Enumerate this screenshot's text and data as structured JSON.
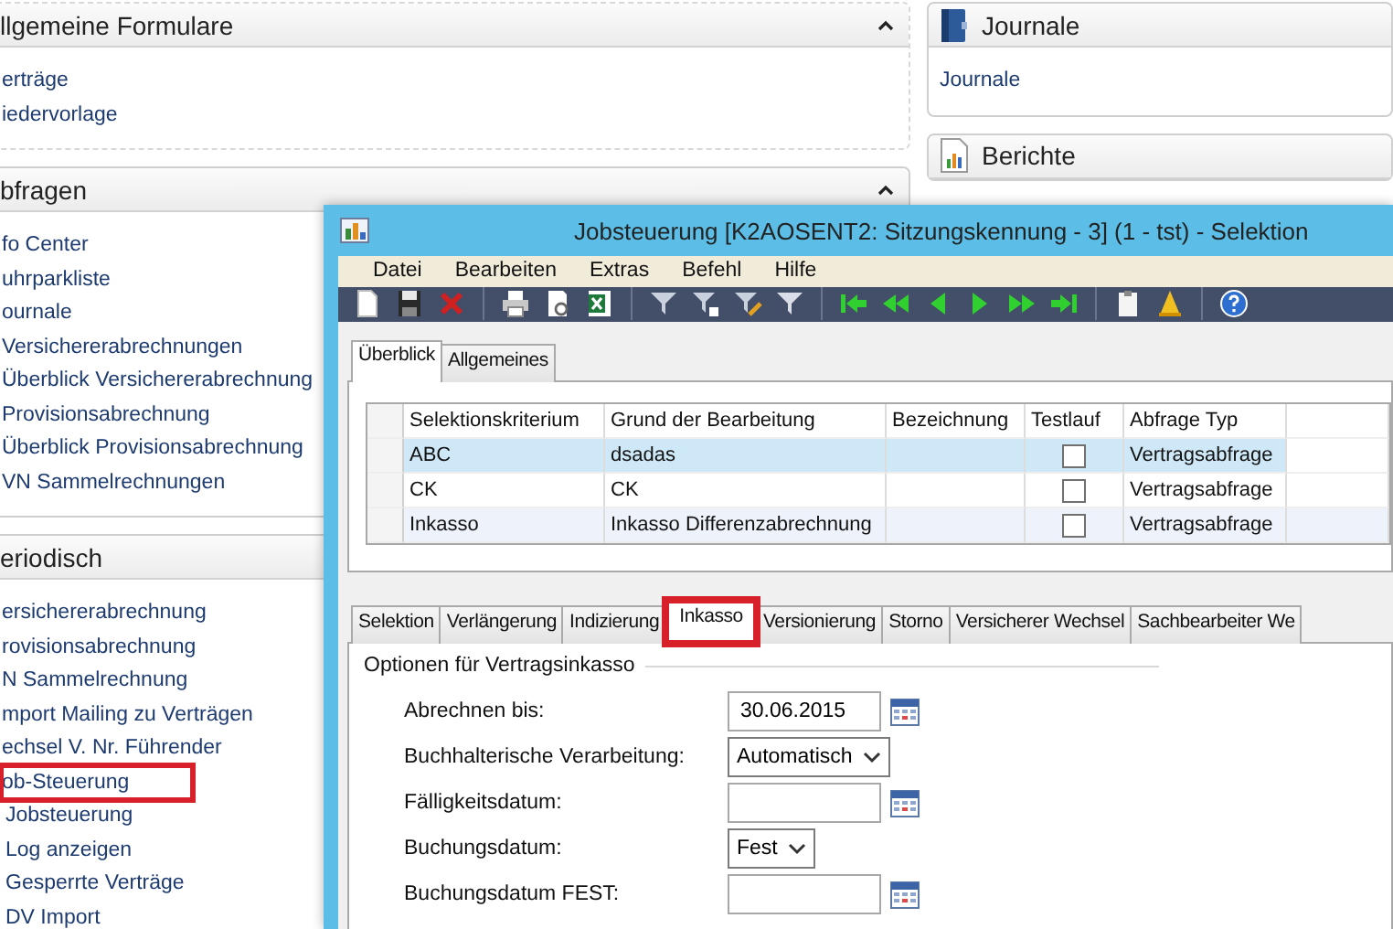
{
  "left_sections": [
    {
      "title": "llgemeine Formulare",
      "expanded": true,
      "items": [
        {
          "label": "erträge",
          "highlighted": false
        },
        {
          "label": "iedervorlage",
          "highlighted": false
        }
      ]
    },
    {
      "title": "bfragen",
      "expanded": true,
      "items": [
        {
          "label": "fo Center",
          "highlighted": false
        },
        {
          "label": "uhrparkliste",
          "highlighted": false
        },
        {
          "label": "ournale",
          "highlighted": false
        },
        {
          "label": "Versichererabrechnungen",
          "highlighted": false
        },
        {
          "label": "Überblick Versichererabrechnung",
          "highlighted": false
        },
        {
          "label": "Provisionsabrechnung",
          "highlighted": false
        },
        {
          "label": "Überblick Provisionsabrechnung",
          "highlighted": false
        },
        {
          "label": "VN Sammelrechnungen",
          "highlighted": false
        }
      ]
    },
    {
      "title": "eriodisch",
      "items": [
        {
          "label": "ersichererabrechnung",
          "highlighted": false
        },
        {
          "label": "rovisionsabrechnung",
          "highlighted": false
        },
        {
          "label": "N Sammelrechnung",
          "highlighted": false
        },
        {
          "label": "mport Mailing zu Verträgen",
          "highlighted": false
        },
        {
          "label": "echsel V. Nr. Führender",
          "highlighted": false
        },
        {
          "label": "ob-Steuerung",
          "highlighted": true
        },
        {
          "label": "Jobsteuerung",
          "highlighted": false
        },
        {
          "label": "Log anzeigen",
          "highlighted": false
        },
        {
          "label": "Gesperrte Verträge",
          "highlighted": false
        },
        {
          "label": "DV Import",
          "highlighted": false
        }
      ]
    }
  ],
  "right_sections": [
    {
      "title": "Journale",
      "items": [
        {
          "label": "Journale",
          "highlighted": false
        }
      ]
    },
    {
      "title": "Berichte"
    }
  ],
  "window": {
    "title": "Jobsteuerung [K2AOSENT2: Sitzungskennung - 3] (1 - tst) - Selektion",
    "menu": [
      "Datei",
      "Bearbeiten",
      "Extras",
      "Befehl",
      "Hilfe"
    ],
    "top_tabs": [
      {
        "label": "Überblick",
        "selected": true
      },
      {
        "label": "Allgemeines",
        "selected": false
      }
    ],
    "table": {
      "columns": [
        "Selektionskriterium",
        "Grund der Bearbeitung",
        "Bezeichnung",
        "Testlauf",
        "Abfrage Typ"
      ],
      "rows": [
        {
          "selektionskriterium": "ABC",
          "grund": "dsadas",
          "testlauf": false,
          "abfrage_typ": "Vertragsabfrage",
          "selected": true
        },
        {
          "selektionskriterium": "CK",
          "grund": "CK",
          "testlauf": false,
          "abfrage_typ": "Vertragsabfrage",
          "selected": false
        },
        {
          "selektionskriterium": "Inkasso",
          "grund": "Inkasso Differenzabrechnung",
          "testlauf": false,
          "abfrage_typ": "Vertragsabfrage",
          "selected": false
        }
      ]
    },
    "bottom_tabs": [
      {
        "label": "Selektion",
        "selected": false,
        "highlighted": false
      },
      {
        "label": "Verlängerung",
        "selected": false,
        "highlighted": false
      },
      {
        "label": "Indizierung",
        "selected": false,
        "highlighted": false
      },
      {
        "label": "Inkasso",
        "selected": true,
        "highlighted": true
      },
      {
        "label": "Versionierung",
        "selected": false,
        "highlighted": false
      },
      {
        "label": "Storno",
        "selected": false,
        "highlighted": false
      },
      {
        "label": "Versicherer Wechsel",
        "selected": false,
        "highlighted": false
      },
      {
        "label": "Sachbearbeiter We",
        "selected": false,
        "highlighted": false
      }
    ],
    "group": {
      "title": "Optionen für Vertragsinkasso",
      "fields": [
        {
          "label": "Abrechnen bis:",
          "kind": "date",
          "value": "30.06.2015"
        },
        {
          "label": "Buchhalterische Verarbeitung:",
          "kind": "select",
          "value": "Automatisch"
        },
        {
          "label": "Fälligkeitsdatum:",
          "kind": "date"
        },
        {
          "label": "Buchungsdatum:",
          "kind": "select",
          "value": "Fest"
        },
        {
          "label": "Buchungsdatum FEST:",
          "kind": "date"
        }
      ]
    }
  }
}
